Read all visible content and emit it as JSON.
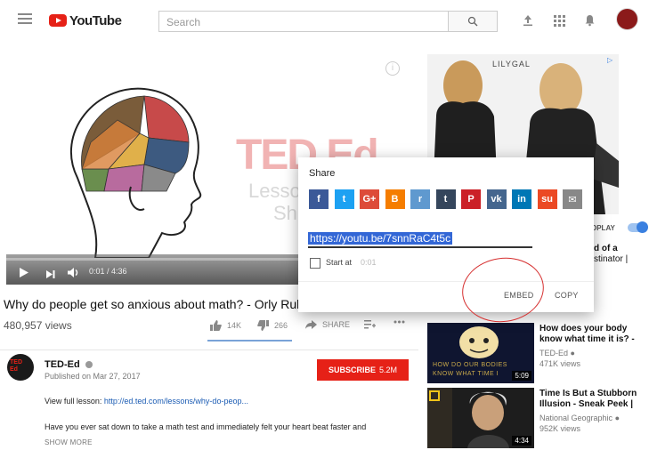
{
  "header": {
    "logo_text": "YouTube",
    "search_placeholder": "Search"
  },
  "video": {
    "overlay_brand": "TED Ed",
    "overlay_sub": "Lesso",
    "overlay_sub2": "Sh",
    "time": "0:01 / 4:36",
    "title": "Why do people get so anxious about math? - Orly Rubinste",
    "views": "480,957 views",
    "likes": "14K",
    "dislikes": "266",
    "share_label": "SHARE"
  },
  "channel": {
    "name": "TED-Ed",
    "published": "Published on Mar 27, 2017",
    "subscribe_label": "SUBSCRIBE",
    "subscribe_count": "5.2M",
    "avatar_text": "TED Ed"
  },
  "description": {
    "lesson_prefix": "View full lesson: ",
    "lesson_link": "http://ed.ted.com/lessons/why-do-peop...",
    "body": "Have you ever sat down to take a math test and immediately felt your heart beat faster and",
    "show_more": "SHOW MORE"
  },
  "ad": {
    "brand": "LILYGAL"
  },
  "sidebar": {
    "autoplay_label": "OPLAY",
    "up_next_line1": "d of a",
    "up_next_line2": "stinator |",
    "items": [
      {
        "title_line1": "How does your body",
        "title_line2": "know what time it is? -",
        "channel": "TED-Ed",
        "views": "471K views",
        "duration": "5:09",
        "thumb_text1": "HOW DO OUR BODIES",
        "thumb_text2": "KNOW WHAT TIME I"
      },
      {
        "title_line1": "Time Is But a Stubborn",
        "title_line2": "Illusion - Sneak Peek |",
        "channel": "National Geographic",
        "views": "952K views",
        "duration": "4:34"
      }
    ]
  },
  "share_dialog": {
    "title": "Share",
    "url": "https://youtu.be/7snnRaC4t5c",
    "start_at_label": "Start at",
    "start_time": "0:01",
    "embed_label": "EMBED",
    "copy_label": "COPY",
    "socials": [
      {
        "name": "facebook",
        "glyph": "f",
        "color": "#3b5998"
      },
      {
        "name": "twitter",
        "glyph": "t",
        "color": "#1da1f2"
      },
      {
        "name": "google-plus",
        "glyph": "G+",
        "color": "#dd4b39"
      },
      {
        "name": "blogger",
        "glyph": "B",
        "color": "#f57d00"
      },
      {
        "name": "reddit",
        "glyph": "r",
        "color": "#5f99cf"
      },
      {
        "name": "tumblr",
        "glyph": "t",
        "color": "#35465c"
      },
      {
        "name": "pinterest",
        "glyph": "P",
        "color": "#cb2027"
      },
      {
        "name": "vk",
        "glyph": "vk",
        "color": "#45668e"
      },
      {
        "name": "linkedin",
        "glyph": "in",
        "color": "#0077b5"
      },
      {
        "name": "stumbleupon",
        "glyph": "su",
        "color": "#eb4924"
      },
      {
        "name": "email",
        "glyph": "✉",
        "color": "#888888"
      }
    ]
  }
}
